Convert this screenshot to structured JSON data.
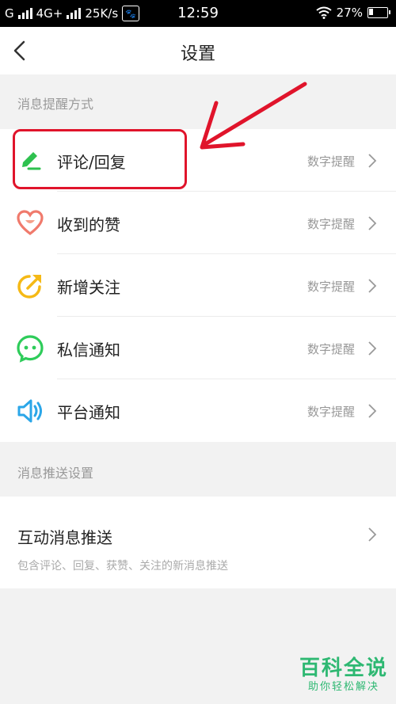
{
  "status_bar": {
    "carrier1": "G",
    "network": "4G+",
    "speed": "25K/s",
    "time": "12:59",
    "battery_percent": "27%",
    "battery_level": 0.27
  },
  "header": {
    "title": "设置"
  },
  "sections": {
    "reminder_label": "消息提醒方式",
    "push_label": "消息推送设置"
  },
  "reminder_items": [
    {
      "label": "评论/回复",
      "value": "数字提醒",
      "icon": "pen-icon"
    },
    {
      "label": "收到的赞",
      "value": "数字提醒",
      "icon": "heart-icon"
    },
    {
      "label": "新增关注",
      "value": "数字提醒",
      "icon": "follow-icon"
    },
    {
      "label": "私信通知",
      "value": "数字提醒",
      "icon": "message-icon"
    },
    {
      "label": "平台通知",
      "value": "数字提醒",
      "icon": "speaker-icon"
    }
  ],
  "push": {
    "title": "互动消息推送",
    "description": "包含评论、回复、获赞、关注的新消息推送"
  },
  "watermark": {
    "title": "百科全说",
    "subtitle": "助你轻松解决"
  },
  "colors": {
    "annotation": "#e0142b",
    "pen": "#2ec14f",
    "heart": "#f07a6c",
    "follow": "#f5b916",
    "message": "#2ecc5a",
    "speaker": "#2aa6e8",
    "watermark": "#2eb872"
  }
}
